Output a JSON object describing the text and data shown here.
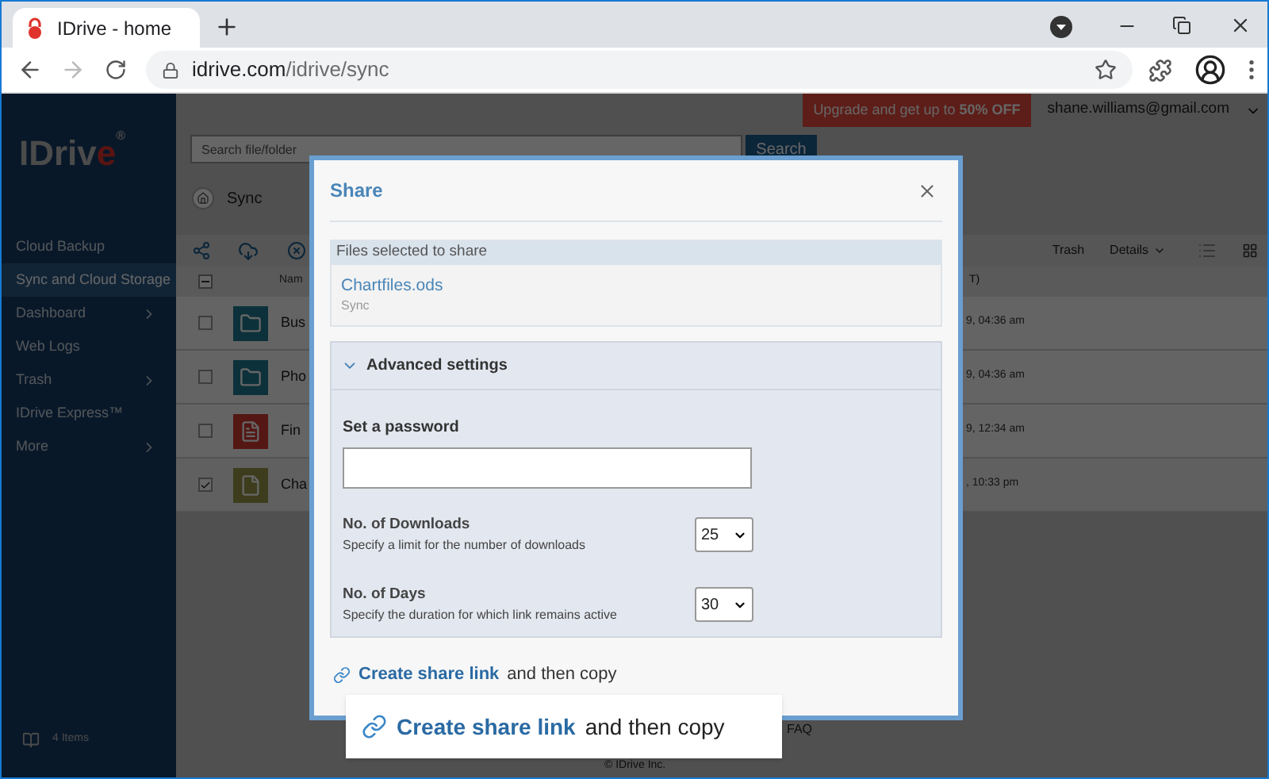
{
  "browser": {
    "tab_title": "IDrive - home",
    "url_domain": "idrive.com",
    "url_path": "/idrive/sync"
  },
  "logo": {
    "main": "IDriv",
    "accent": "e",
    "symbol": "®"
  },
  "header": {
    "upgrade": "Upgrade and get up to **50% OFF**",
    "account": "shane.williams@gmail.com"
  },
  "search": {
    "placeholder": "Search file/folder",
    "button": "Search"
  },
  "breadcrumb": "Sync",
  "sidebar": {
    "items": [
      {
        "label": "Cloud Backup",
        "selected": false,
        "submenu": false
      },
      {
        "label": "Sync and Cloud Storage",
        "selected": true,
        "submenu": false
      },
      {
        "label": "Dashboard",
        "selected": false,
        "submenu": true
      },
      {
        "label": "Web Logs",
        "selected": false,
        "submenu": false
      },
      {
        "label": "Trash",
        "selected": false,
        "submenu": true
      },
      {
        "label": "IDrive Express™",
        "selected": false,
        "submenu": false
      },
      {
        "label": "More",
        "selected": false,
        "submenu": true
      }
    ],
    "footer": "4 Items"
  },
  "toolbar": {
    "trash": "Trash",
    "details": "Details"
  },
  "table": {
    "select_all_indeterminate": true,
    "columns": [
      "Nam",
      "T)"
    ],
    "rows": [
      {
        "name": "Bus",
        "date": "9, 04:36 am",
        "kind": "folder",
        "selected": false
      },
      {
        "name": "Pho",
        "date": "9, 04:36 am",
        "kind": "folder",
        "selected": false
      },
      {
        "name": "Fin",
        "date": "9, 12:34 am",
        "kind": "document",
        "selected": false
      },
      {
        "name": "Cha",
        "date": ", 10:33 pm",
        "kind": "sheet",
        "selected": true
      }
    ]
  },
  "footer": {
    "faq": "FAQ",
    "copyright": "© IDrive Inc."
  },
  "dialog": {
    "title": "Share",
    "files_heading": "Files selected to share",
    "file": {
      "name": "Chartfiles.ods",
      "location": "Sync"
    },
    "advanced": {
      "title": "Advanced settings",
      "expanded": true,
      "password_label": "Set a password",
      "options": [
        {
          "title": "No. of Downloads",
          "hint": "Specify a limit for the number of downloads",
          "value": "25"
        },
        {
          "title": "No. of Days",
          "hint": "Specify the duration for which link remains active",
          "value": "30"
        }
      ]
    },
    "action": {
      "link": "Create share link",
      "rest": "and then copy"
    }
  },
  "callout": {
    "link": "Create share link",
    "rest": "and then copy"
  }
}
